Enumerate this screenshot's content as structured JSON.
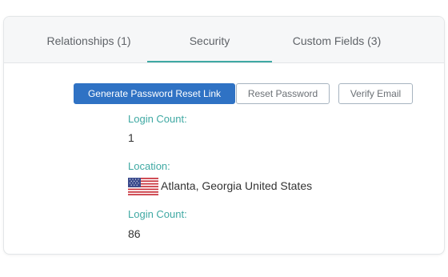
{
  "tabs": {
    "relationships": "Relationships (1)",
    "security": "Security",
    "custom_fields": "Custom Fields (3)"
  },
  "buttons": {
    "generate_reset_link": "Generate Password Reset Link",
    "reset_password": "Reset Password",
    "verify_email": "Verify Email"
  },
  "fields": {
    "login_count_label_1": "Login Count:",
    "login_count_value_1": "1",
    "location_label": "Location:",
    "location_value": "Atlanta, Georgia United States",
    "location_flag_icon": "us-flag-icon",
    "login_count_label_2": "Login Count:",
    "login_count_value_2": "86"
  },
  "colors": {
    "accent": "#3fa9a3",
    "primary_button": "#2f72c4",
    "outline_border": "#a7b4c0"
  }
}
